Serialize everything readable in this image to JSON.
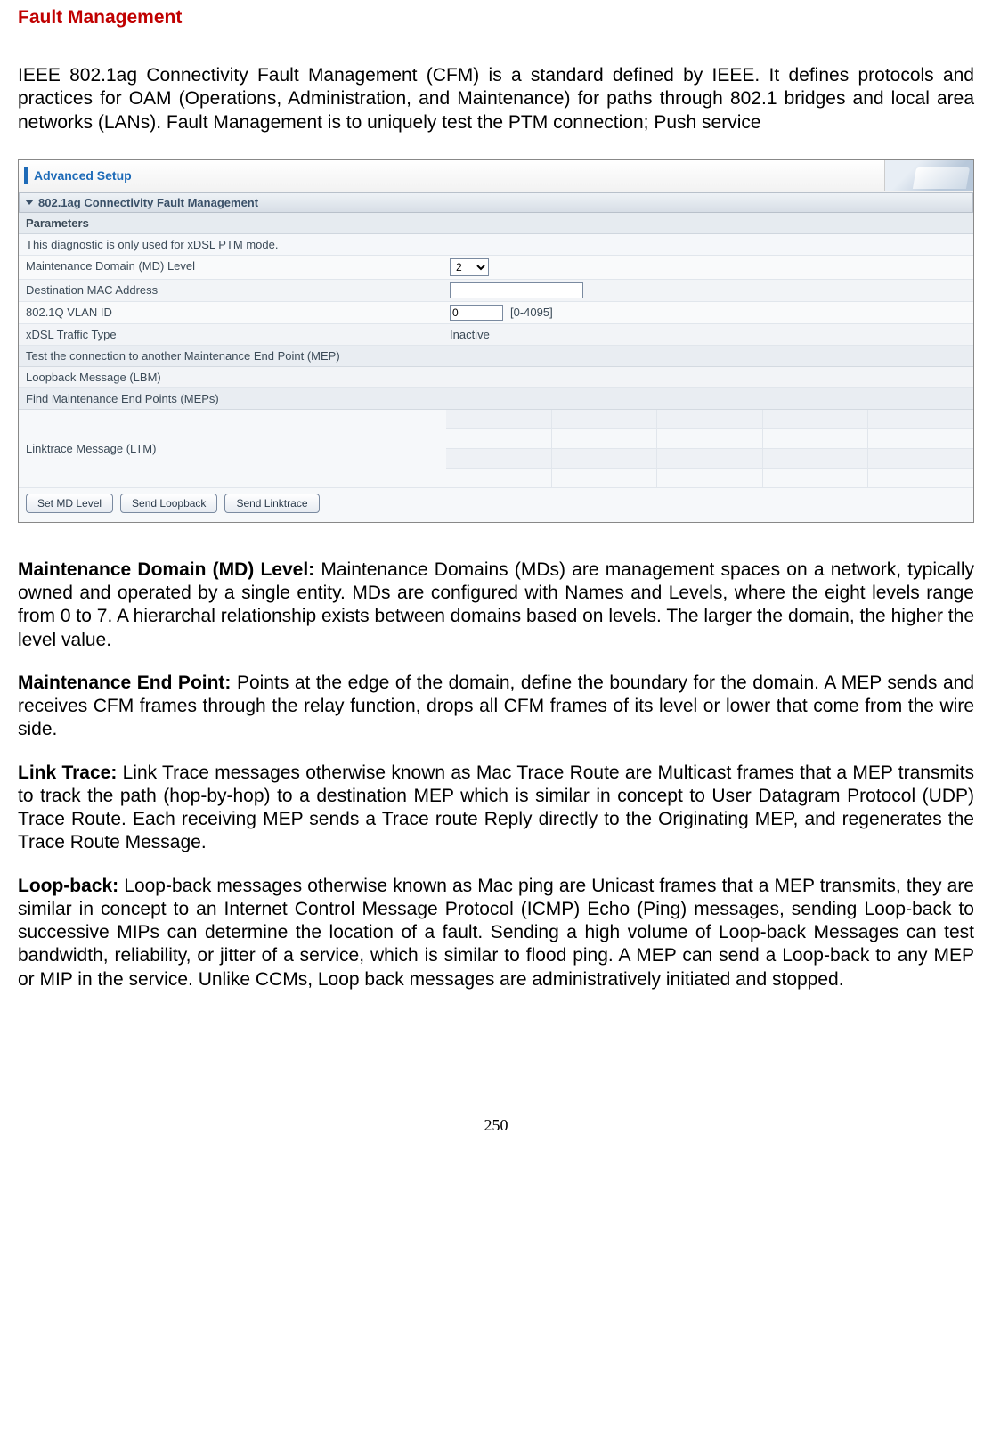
{
  "heading": "Fault Management",
  "intro": "IEEE 802.1ag Connectivity Fault Management (CFM) is a standard defined by IEEE. It defines protocols and practices for OAM (Operations, Administration, and Maintenance) for paths through 802.1 bridges and local area networks (LANs). Fault Management is to uniquely test the PTM connection; Push service",
  "screenshot": {
    "header_title": "Advanced Setup",
    "section_title": "802.1ag Connectivity Fault Management",
    "parameters_label": "Parameters",
    "diag_note": "This diagnostic is only used for xDSL PTM mode.",
    "rows": {
      "md_level_label": "Maintenance Domain (MD) Level",
      "md_level_value": "2",
      "dest_mac_label": "Destination MAC Address",
      "dest_mac_value": "",
      "vlan_label": "802.1Q VLAN ID",
      "vlan_value": "0",
      "vlan_range": "[0-4095]",
      "xdsl_label": "xDSL Traffic Type",
      "xdsl_value": "Inactive",
      "test_mep_label": "Test the connection to another Maintenance End Point (MEP)",
      "lbm_label": "Loopback Message (LBM)",
      "find_meps_label": "Find Maintenance End Points (MEPs)",
      "ltm_label": "Linktrace Message (LTM)"
    },
    "buttons": {
      "set_md": "Set MD Level",
      "send_loopback": "Send Loopback",
      "send_linktrace": "Send Linktrace"
    }
  },
  "defs": {
    "md_level_term": "Maintenance Domain (MD) Level:",
    "md_level_text": " Maintenance Domains (MDs) are management spaces on a network, typically owned and operated by a single entity. MDs are configured with Names and Levels, where the eight levels range from 0 to 7. A hierarchal relationship exists between domains based on levels. The larger the domain, the higher the level value.",
    "mep_term": "Maintenance End Point:",
    "mep_text": " Points at the edge of the domain, define the boundary for the domain. A MEP sends and receives CFM frames through the relay function, drops all CFM frames of its level or lower that come from the wire side.",
    "linktrace_term": "Link Trace:",
    "linktrace_text": " Link Trace messages otherwise known as Mac Trace Route are Multicast frames that a MEP transmits to track the path (hop-by-hop) to a destination MEP which is similar in concept to User Datagram Protocol (UDP) Trace Route. Each receiving MEP sends a Trace route Reply directly to the Originating MEP, and regenerates the Trace Route Message.",
    "loopback_term": "Loop-back:",
    "loopback_text": " Loop-back messages otherwise known as Mac ping are Unicast frames that a MEP transmits, they are similar in concept to an Internet Control Message Protocol (ICMP) Echo (Ping) messages, sending Loop-back to successive MIPs can determine the location of a fault. Sending a high volume of Loop-back Messages can test bandwidth, reliability, or jitter of a service, which is similar to flood ping. A MEP can send a Loop-back to any MEP or MIP in the service. Unlike CCMs, Loop back messages are administratively initiated and stopped."
  },
  "page_number": "250"
}
